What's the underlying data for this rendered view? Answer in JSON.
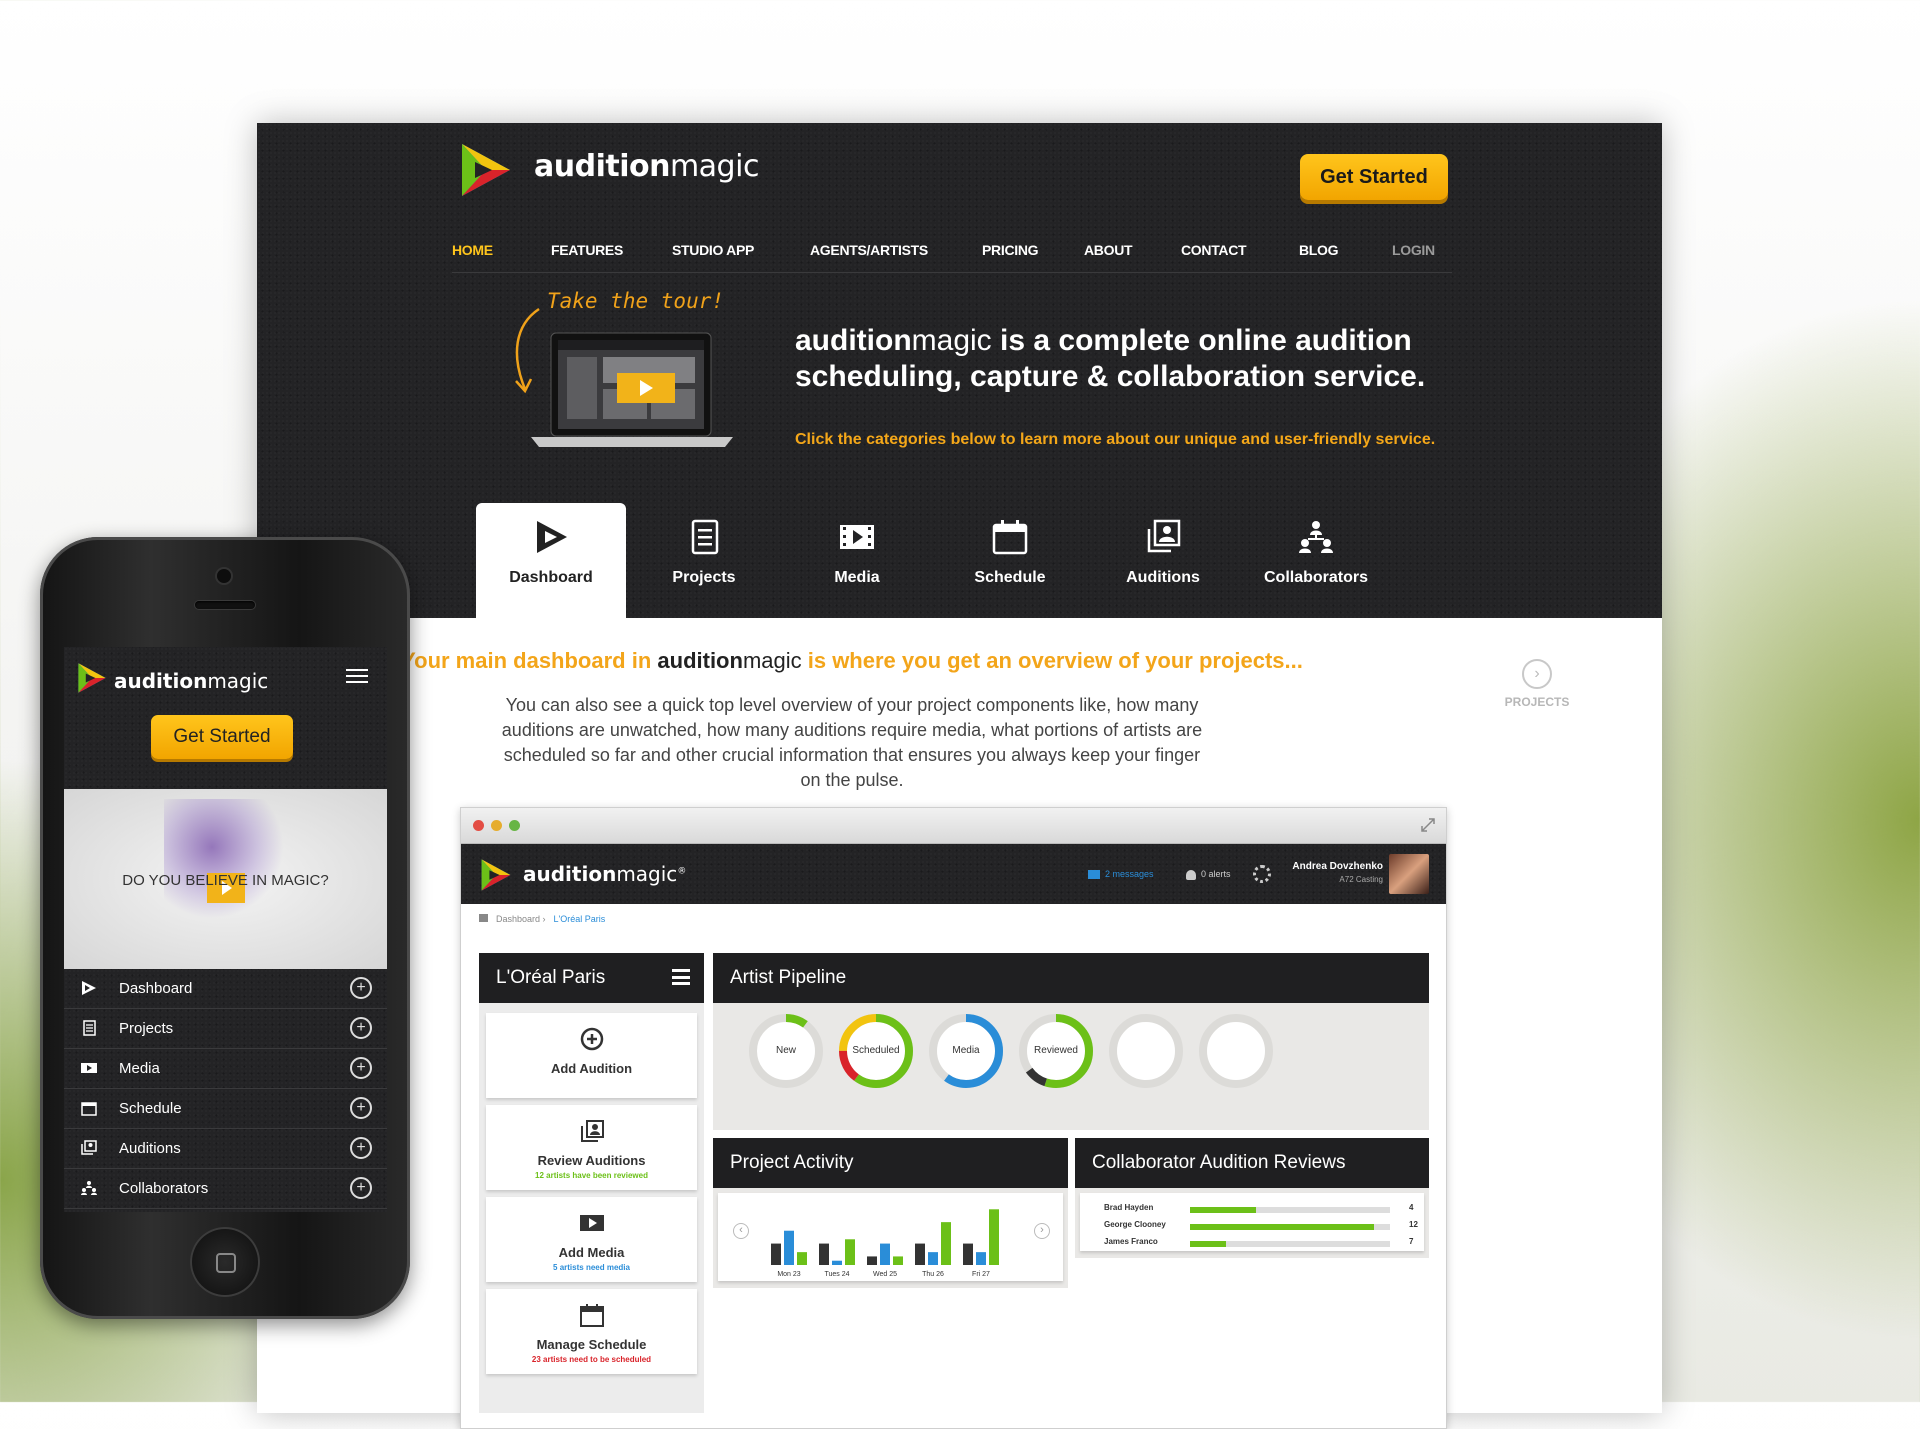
{
  "site": {
    "brand": {
      "bold": "audition",
      "light": "magic"
    },
    "cta": "Get Started",
    "nav": [
      "HOME",
      "FEATURES",
      "STUDIO APP",
      "AGENTS/ARTISTS",
      "PRICING",
      "ABOUT",
      "CONTACT",
      "BLOG",
      "LOGIN"
    ],
    "tour_label": "Take the tour!",
    "headline": {
      "bold": "audition",
      "light": "magic",
      "rest": " is a complete online audition scheduling, capture & collaboration service."
    },
    "subline": "Click the categories below to learn more about our unique and user-friendly service.",
    "tabs": [
      "Dashboard",
      "Projects",
      "Media",
      "Schedule",
      "Auditions",
      "Collaborators"
    ],
    "lead": {
      "pre": "Your main dashboard in ",
      "brand_bold": "audition",
      "brand_light": "magic",
      "post": " is where you get an overview of your projects..."
    },
    "description": "You can also see a quick top level overview of your project components like, how many auditions are unwatched, how many auditions require media, what portions of artists are scheduled so far and other crucial information that ensures you always keep your finger on the pulse.",
    "next_label": "PROJECTS",
    "colors": {
      "accent": "#ffc51c",
      "dark": "#232325",
      "green": "#6cc018",
      "blue": "#2a8dd8",
      "red": "#d9232a"
    }
  },
  "app": {
    "brand": {
      "bold": "audition",
      "light": "magic",
      "mark": "®"
    },
    "messages": "2 messages",
    "alerts": "0 alerts",
    "user": {
      "name": "Andrea Dovzhenko",
      "company": "A72 Casting"
    },
    "breadcrumb": {
      "root": "Dashboard ›",
      "current": "L'Oréal Paris"
    },
    "project_panel": {
      "title": "L'Oréal Paris",
      "actions": [
        {
          "label": "Add Audition",
          "sub": "",
          "sub_color": "#333333",
          "icon": "plus-circle-icon"
        },
        {
          "label": "Review Auditions",
          "sub": "12 artists have been reviewed",
          "sub_color": "#6cc018",
          "icon": "auditions-icon"
        },
        {
          "label": "Add Media",
          "sub": "5 artists need media",
          "sub_color": "#2a8dd8",
          "icon": "film-icon"
        },
        {
          "label": "Manage Schedule",
          "sub": "23 artists need to be scheduled",
          "sub_color": "#d9232a",
          "icon": "calendar-icon"
        }
      ]
    },
    "pipeline": {
      "title": "Artist Pipeline",
      "rings": [
        {
          "label": "New",
          "segments": [
            {
              "color": "#6cc018",
              "frac": 0.1
            }
          ]
        },
        {
          "label": "Scheduled",
          "segments": [
            {
              "color": "#6cc018",
              "frac": 0.6
            },
            {
              "color": "#d9232a",
              "frac": 0.15
            },
            {
              "color": "#f2c40f",
              "frac": 0.25
            }
          ]
        },
        {
          "label": "Media",
          "segments": [
            {
              "color": "#2a8dd8",
              "frac": 0.6
            }
          ]
        },
        {
          "label": "Reviewed",
          "segments": [
            {
              "color": "#6cc018",
              "frac": 0.55
            },
            {
              "color": "#333333",
              "frac": 0.1
            }
          ]
        },
        {
          "label": "",
          "segments": []
        },
        {
          "label": "",
          "segments": []
        }
      ]
    },
    "activity": {
      "title": "Project Activity"
    },
    "reviews": {
      "title": "Collaborator Audition Reviews",
      "rows": [
        {
          "name": "Brad Hayden",
          "value": 4,
          "frac": 0.33
        },
        {
          "name": "George Clooney",
          "value": 12,
          "frac": 0.92
        },
        {
          "name": "James Franco",
          "value": 7,
          "frac": 0.18
        }
      ]
    }
  },
  "chart_data": {
    "type": "bar",
    "title": "Project Activity",
    "categories": [
      "Mon 23",
      "Tues 24",
      "Wed 25",
      "Thu 26",
      "Fri 27"
    ],
    "series": [
      {
        "values": [
          5,
          5,
          2,
          5,
          5
        ],
        "color": "#333333"
      },
      {
        "values": [
          8,
          1,
          5,
          3,
          3
        ],
        "color": "#2a8dd8"
      },
      {
        "values": [
          3,
          6,
          2,
          10,
          13
        ],
        "color": "#6cc018"
      }
    ],
    "ylim": [
      0,
      14
    ],
    "xlabel": "",
    "ylabel": ""
  },
  "phone": {
    "brand": {
      "bold": "audition",
      "light": "magic"
    },
    "cta": "Get Started",
    "hero_text": "DO YOU BELIEVE IN MAGIC?",
    "menu": [
      "Dashboard",
      "Projects",
      "Media",
      "Schedule",
      "Auditions",
      "Collaborators"
    ]
  }
}
